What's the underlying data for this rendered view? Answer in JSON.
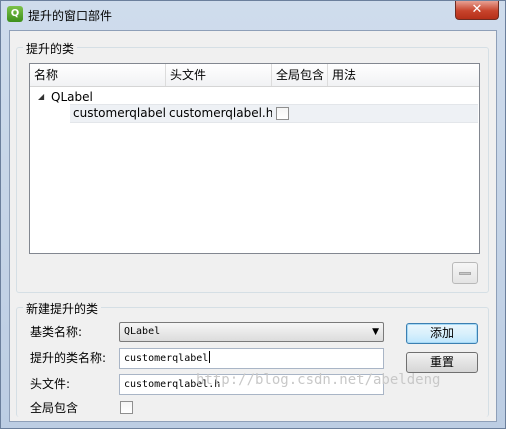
{
  "window": {
    "title": "提升的窗口部件",
    "app_icon_glyph": "Q",
    "close_glyph": "✕"
  },
  "promoted_classes": {
    "group_title": "提升的类",
    "columns": [
      "名称",
      "头文件",
      "全局包含",
      "用法"
    ],
    "tree": {
      "base_class": "QLabel",
      "expanded": true,
      "children": [
        {
          "name": "customerqlabel",
          "header": "customerqlabel.h",
          "global_include": false,
          "usage": ""
        }
      ]
    },
    "remove_icon": "minus-icon"
  },
  "new_promoted_class": {
    "group_title": "新建提升的类",
    "base_class_label": "基类名称:",
    "base_class_value": "QLabel",
    "promoted_class_label": "提升的类名称:",
    "promoted_class_value": "customerqlabel",
    "header_file_label": "头文件:",
    "header_file_value": "customerqlabel.h",
    "global_include_label": "全局包含",
    "global_include_checked": false,
    "add_button": "添加",
    "reset_button": "重置"
  },
  "watermark": "http://blog.csdn.net/abeldeng",
  "colors": {
    "titlebar": "#c9d7ea",
    "close_button": "#c7432b",
    "default_button": "#bee6fd"
  }
}
